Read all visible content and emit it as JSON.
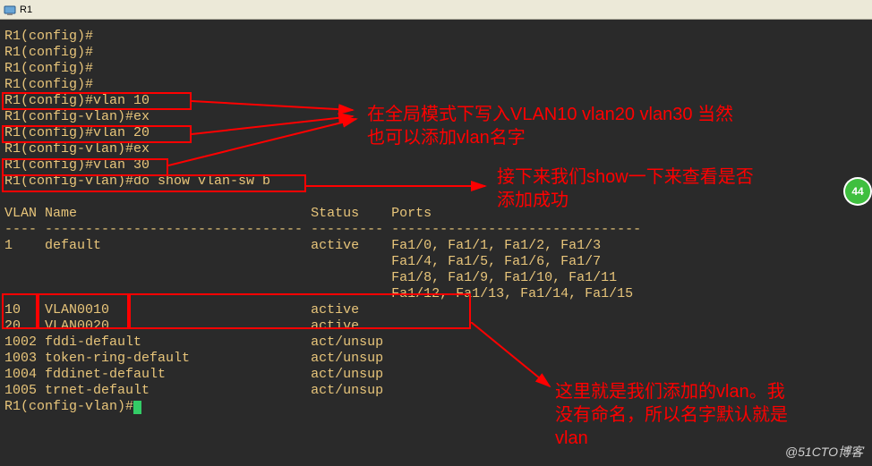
{
  "window": {
    "title": "R1"
  },
  "prompts": {
    "config": "R1(config)#",
    "config_vlan": "R1(config-vlan)#",
    "ex": "ex",
    "vlan10": "vlan 10",
    "vlan20": "vlan 20",
    "vlan30": "vlan 30",
    "do_show": "do show vlan-sw b"
  },
  "table": {
    "header_vlan": "VLAN",
    "header_name": "Name",
    "header_status": "Status",
    "header_ports": "Ports"
  },
  "rows": {
    "r1_id": "1",
    "r1_name": "default",
    "r1_status": "active",
    "r1_ports1": "Fa1/0, Fa1/1, Fa1/2, Fa1/3",
    "r1_ports2": "Fa1/4, Fa1/5, Fa1/6, Fa1/7",
    "r1_ports3": "Fa1/8, Fa1/9, Fa1/10, Fa1/11",
    "r1_ports4": "Fa1/12, Fa1/13, Fa1/14, Fa1/15",
    "r10_id": "10",
    "r10_name": "VLAN0010",
    "r10_status": "active",
    "r20_id": "20",
    "r20_name": "VLAN0020",
    "r20_status": "active",
    "r1002_id": "1002",
    "r1002_name": "fddi-default",
    "r1002_status": "act/unsup",
    "r1003_id": "1003",
    "r1003_name": "token-ring-default",
    "r1003_status": "act/unsup",
    "r1004_id": "1004",
    "r1004_name": "fddinet-default",
    "r1004_status": "act/unsup",
    "r1005_id": "1005",
    "r1005_name": "trnet-default",
    "r1005_status": "act/unsup"
  },
  "annotations": {
    "a1_l1": "在全局模式下写入VLAN10 vlan20 vlan30 当然",
    "a1_l2": "也可以添加vlan名字",
    "a2_l1": "接下来我们show一下来查看是否",
    "a2_l2": "添加成功",
    "a3_l1": "这里就是我们添加的vlan。我",
    "a3_l2": "没有命名，所以名字默认就是",
    "a3_l3": "vlan"
  },
  "badge": {
    "value": "44"
  },
  "watermark": "@51CTO博客",
  "chart_data": {
    "type": "table",
    "title": "VLAN table (do show vlan-sw b)",
    "columns": [
      "VLAN",
      "Name",
      "Status",
      "Ports"
    ],
    "rows": [
      {
        "VLAN": 1,
        "Name": "default",
        "Status": "active",
        "Ports": "Fa1/0, Fa1/1, Fa1/2, Fa1/3, Fa1/4, Fa1/5, Fa1/6, Fa1/7, Fa1/8, Fa1/9, Fa1/10, Fa1/11, Fa1/12, Fa1/13, Fa1/14, Fa1/15"
      },
      {
        "VLAN": 10,
        "Name": "VLAN0010",
        "Status": "active",
        "Ports": ""
      },
      {
        "VLAN": 20,
        "Name": "VLAN0020",
        "Status": "active",
        "Ports": ""
      },
      {
        "VLAN": 1002,
        "Name": "fddi-default",
        "Status": "act/unsup",
        "Ports": ""
      },
      {
        "VLAN": 1003,
        "Name": "token-ring-default",
        "Status": "act/unsup",
        "Ports": ""
      },
      {
        "VLAN": 1004,
        "Name": "fddinet-default",
        "Status": "act/unsup",
        "Ports": ""
      },
      {
        "VLAN": 1005,
        "Name": "trnet-default",
        "Status": "act/unsup",
        "Ports": ""
      }
    ]
  }
}
